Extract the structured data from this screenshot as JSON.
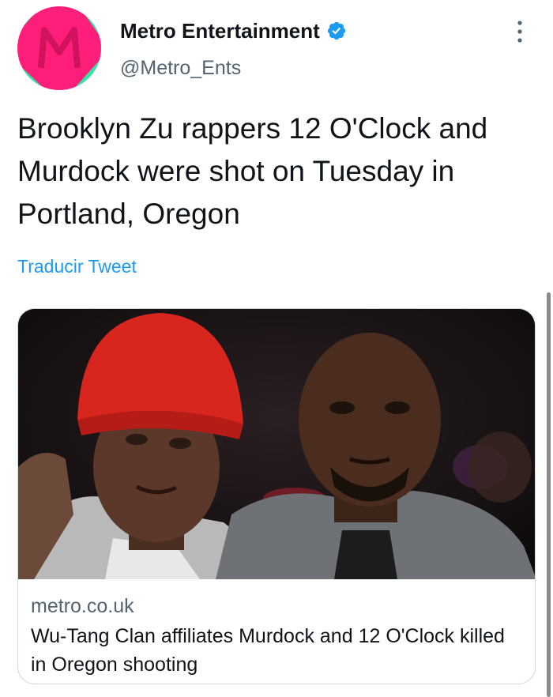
{
  "author": {
    "display_name": "Metro Entertainment",
    "handle": "@Metro_Ents",
    "verified": true,
    "avatar_icon": "metro-logo-icon",
    "avatar_colors": {
      "background": "#ff1f7a",
      "accent": "#2ee6a6"
    }
  },
  "tweet": {
    "text": "Brooklyn Zu rappers 12 O'Clock and Murdock were shot on Tuesday in Portland, Oregon",
    "translate_label": "Traducir Tweet"
  },
  "link_card": {
    "domain": "metro.co.uk",
    "title": "Wu-Tang Clan affiliates Murdock and 12 O'Clock killed in Oregon shooting",
    "image_icon": "photo-two-men-image"
  },
  "colors": {
    "text_primary": "#0f1419",
    "text_secondary": "#536471",
    "link": "#1d9bf0",
    "verified_badge": "#1d9bf0"
  }
}
